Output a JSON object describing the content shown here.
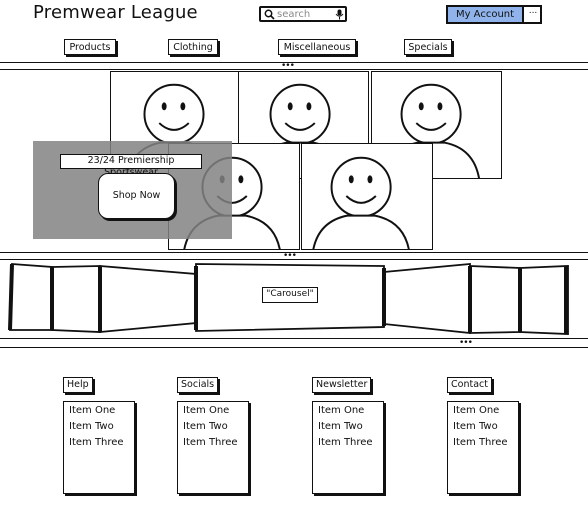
{
  "header": {
    "brand": "Premwear League",
    "search_placeholder": "search",
    "account_label": "My Account",
    "account_more": "..."
  },
  "nav": {
    "items": [
      {
        "label": "Products"
      },
      {
        "label": "Clothing"
      },
      {
        "label": "Miscellaneous"
      },
      {
        "label": "Specials"
      }
    ]
  },
  "hero": {
    "title": "23/24 Premiership Sportswear",
    "cta_label": "Shop Now",
    "images": [
      "avatar-image",
      "avatar-image",
      "avatar-image",
      "avatar-image",
      "avatar-image"
    ]
  },
  "carousel": {
    "label": "\"Carousel\""
  },
  "footer": {
    "columns": [
      {
        "title": "Help",
        "items": [
          "Item One",
          "Item Two",
          "Item Three"
        ]
      },
      {
        "title": "Socials",
        "items": [
          "Item One",
          "Item Two",
          "Item Three"
        ]
      },
      {
        "title": "Newsletter",
        "items": [
          "Item One",
          "Item Two",
          "Item Three"
        ]
      },
      {
        "title": "Contact",
        "items": [
          "Item One",
          "Item Two",
          "Item Three"
        ]
      }
    ]
  },
  "colors": {
    "accent": "#8fb3ea",
    "overlay": "#828282"
  }
}
